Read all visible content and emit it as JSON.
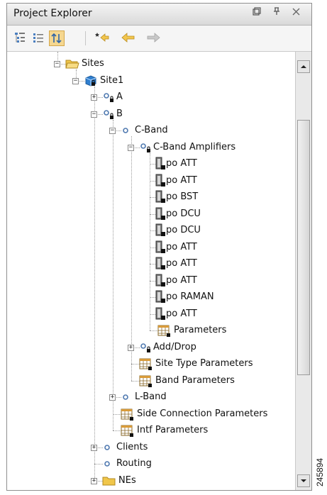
{
  "panel": {
    "title": "Project Explorer",
    "controls": {
      "restore_icon": "restore-icon",
      "pin_icon": "pin-icon",
      "close_icon": "close-icon"
    }
  },
  "toolbar": {
    "buttons": [
      {
        "name": "tree-view-button",
        "icon": "tree-view-icon",
        "active": false
      },
      {
        "name": "list-view-button",
        "icon": "list-view-icon",
        "active": false
      },
      {
        "name": "sort-button",
        "icon": "sort-icon",
        "active": true
      },
      {
        "name": "new-button",
        "icon": "star-arrow-icon",
        "active": false
      },
      {
        "name": "back-button",
        "icon": "arrow-left-icon",
        "active": false
      },
      {
        "name": "forward-button",
        "icon": "arrow-right-icon",
        "active": false
      }
    ]
  },
  "tree": {
    "items": [
      {
        "label": "Sites",
        "level": 0,
        "icon": "folder-open",
        "expander": "minus"
      },
      {
        "label": "Site1",
        "level": 1,
        "icon": "site",
        "expander": "minus"
      },
      {
        "label": "A",
        "level": 2,
        "icon": "node-locked",
        "expander": "plus"
      },
      {
        "label": "B",
        "level": 2,
        "icon": "node-locked",
        "expander": "minus"
      },
      {
        "label": "C-Band",
        "level": 3,
        "icon": "node",
        "expander": "minus"
      },
      {
        "label": "C-Band Amplifiers",
        "level": 4,
        "icon": "node-locked",
        "expander": "minus"
      },
      {
        "label": "po ATT",
        "level": 5,
        "icon": "card"
      },
      {
        "label": "po ATT",
        "level": 5,
        "icon": "card"
      },
      {
        "label": "po BST",
        "level": 5,
        "icon": "card"
      },
      {
        "label": "po DCU",
        "level": 5,
        "icon": "card"
      },
      {
        "label": "po DCU",
        "level": 5,
        "icon": "card"
      },
      {
        "label": "po ATT",
        "level": 5,
        "icon": "card"
      },
      {
        "label": "po ATT",
        "level": 5,
        "icon": "card"
      },
      {
        "label": "po ATT",
        "level": 5,
        "icon": "card"
      },
      {
        "label": "po RAMAN",
        "level": 5,
        "icon": "card"
      },
      {
        "label": "po ATT",
        "level": 5,
        "icon": "card"
      },
      {
        "label": "Parameters",
        "level": 5,
        "icon": "table"
      },
      {
        "label": "Add/Drop",
        "level": 4,
        "icon": "node-locked",
        "expander": "plus"
      },
      {
        "label": "Site Type Parameters",
        "level": 4,
        "icon": "table"
      },
      {
        "label": "Band Parameters",
        "level": 4,
        "icon": "table"
      },
      {
        "label": "L-Band",
        "level": 3,
        "icon": "node",
        "expander": "plus"
      },
      {
        "label": "Side Connection Parameters",
        "level": 3,
        "icon": "table"
      },
      {
        "label": "Intf Parameters",
        "level": 3,
        "icon": "table"
      },
      {
        "label": "Clients",
        "level": 2,
        "icon": "node",
        "expander": "plus"
      },
      {
        "label": "Routing",
        "level": 2,
        "icon": "node"
      },
      {
        "label": "NEs",
        "level": 2,
        "icon": "folder",
        "expander": "plus"
      }
    ]
  },
  "figure_number": "245894",
  "colors": {
    "accent": "#f5d790",
    "folder": "#f0c64a",
    "site": "#2f7fd0"
  }
}
